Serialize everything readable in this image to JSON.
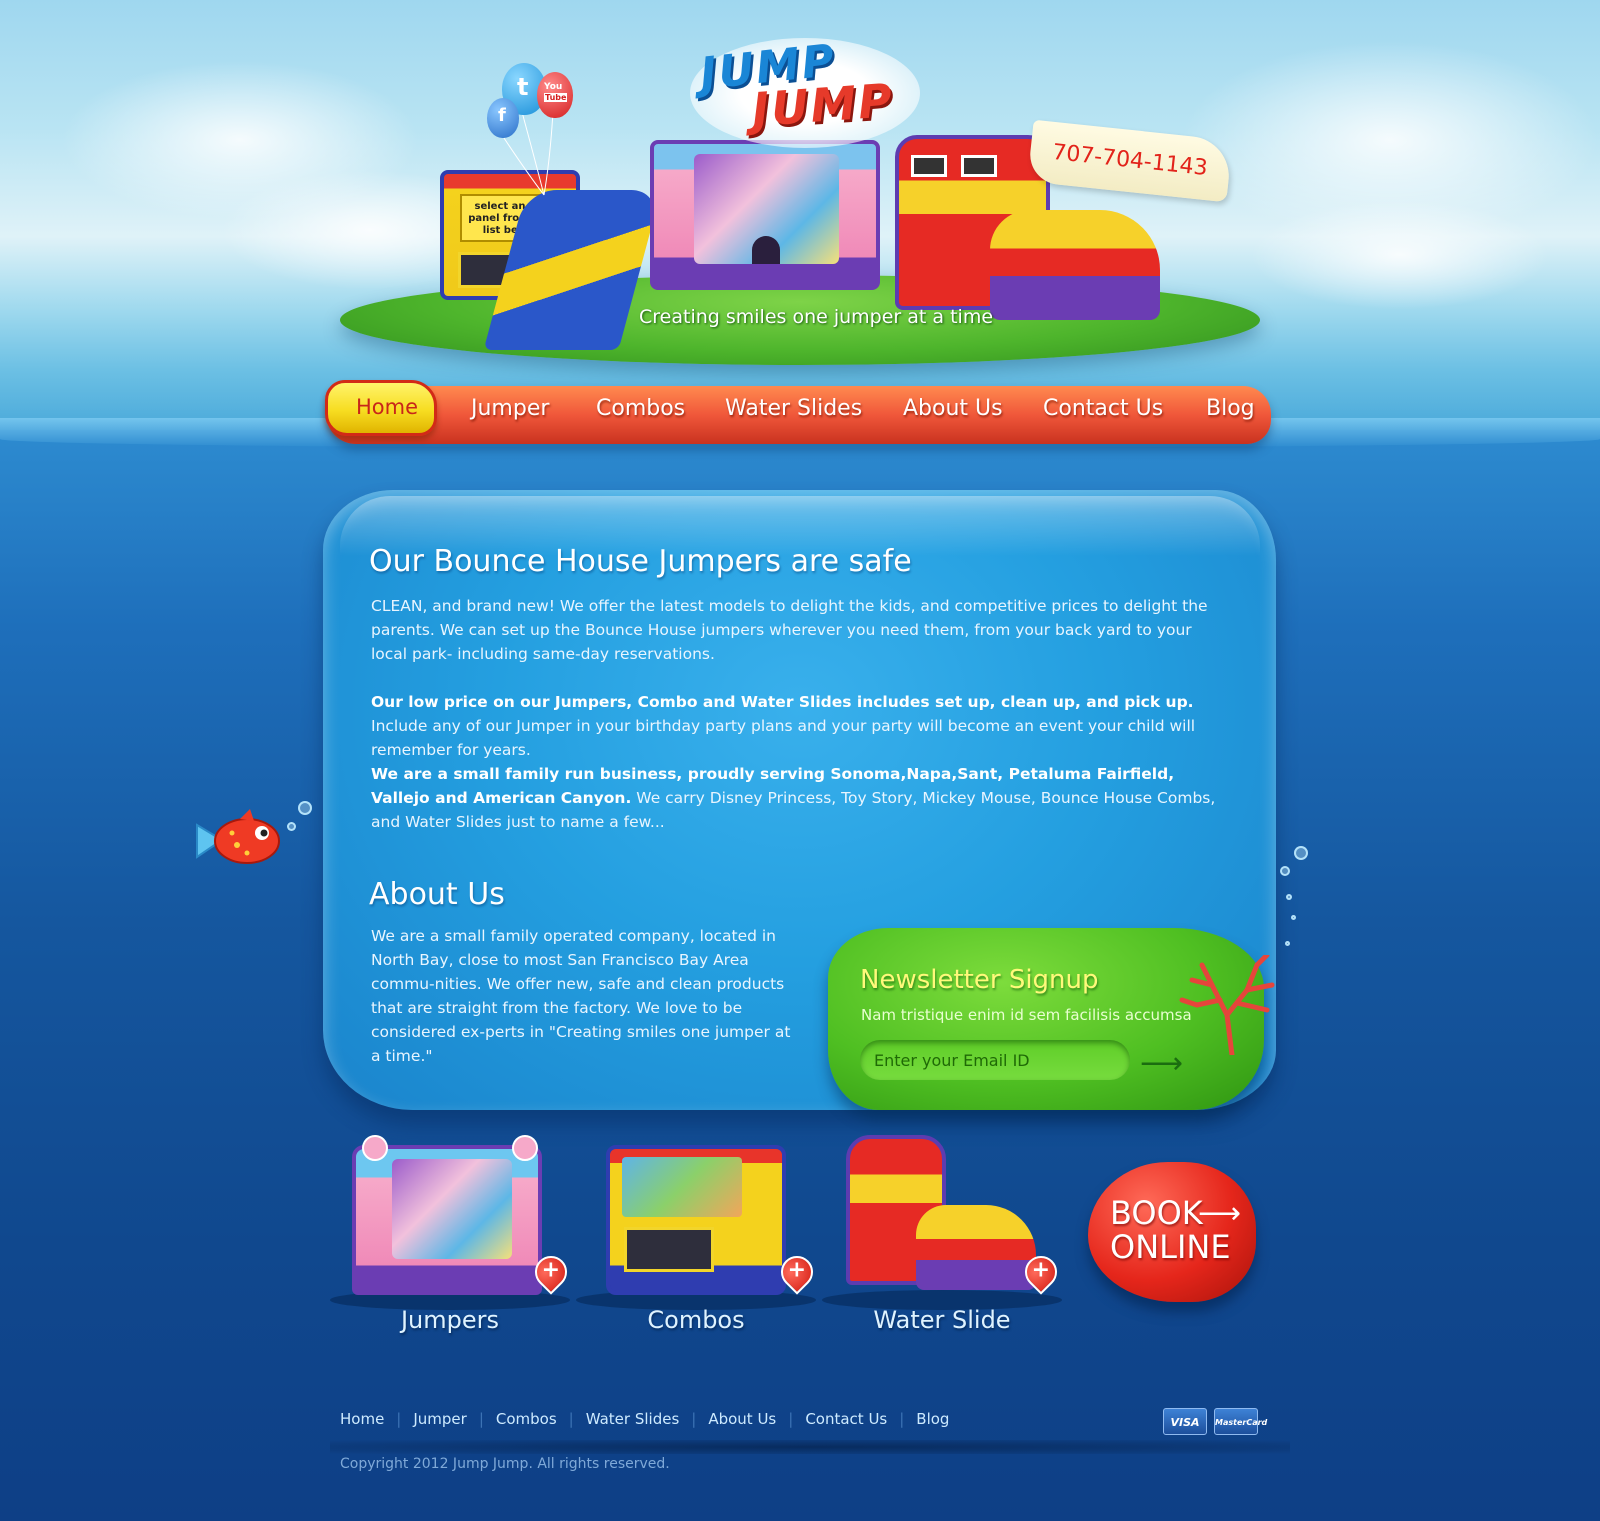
{
  "header": {
    "logo_line1": "JUMP",
    "logo_line2": "JUMP",
    "tagline": "Creating smiles one jumper at a time",
    "phone": "707-704-1143",
    "art_panel": "select an art panel from the list below",
    "social": [
      {
        "name": "twitter-icon",
        "glyph": "t"
      },
      {
        "name": "youtube-icon",
        "line1": "You",
        "line2": "Tube"
      },
      {
        "name": "facebook-icon",
        "glyph": "f"
      }
    ]
  },
  "nav": {
    "items": [
      "Home",
      "Jumper",
      "Combos",
      "Water Slides",
      "About Us",
      "Contact Us",
      "Blog"
    ],
    "active": "Home"
  },
  "main": {
    "safe_title": "Our Bounce House Jumpers are safe",
    "safe_p1": "CLEAN, and brand new! We offer the latest models to delight the kids, and competitive prices to delight the parents. We can set up the Bounce House jumpers wherever you need them, from your back yard to your local park- including same-day reservations.",
    "safe_p2_bold": "Our low price on our Jumpers, Combo and Water Slides includes set up, clean up, and pick up.",
    "safe_p2_rest": " Include any of our Jumper in your birthday party plans and your party will become an event your child will remember for years.",
    "safe_p3_bold": "We are a small family run business, proudly serving Sonoma,Napa,Sant, Petaluma Fairfield, Vallejo and American Canyon.",
    "safe_p3_rest": " We carry Disney Princess, Toy Story, Mickey Mouse, Bounce House Combs, and Water Slides just to name a few...",
    "about_title": "About Us",
    "about_text": "We are a small family operated company, located in North Bay, close to most San Francisco Bay Area commu-nities. We offer new, safe and clean products that are straight from the factory. We love to be considered ex-perts in \"Creating smiles one jumper at a time.\""
  },
  "newsletter": {
    "title": "Newsletter Signup",
    "subtitle": "Nam tristique enim id sem facilisis accumsa",
    "placeholder": "Enter your Email ID",
    "value": ""
  },
  "products": [
    {
      "label": "Jumpers"
    },
    {
      "label": "Combos"
    },
    {
      "label": "Water Slide"
    }
  ],
  "book": {
    "line1": "BOOK",
    "line2": "ONLINE"
  },
  "footer": {
    "links": [
      "Home",
      "Jumper",
      "Combos",
      "Water Slides",
      "About Us",
      "Contact Us",
      "Blog"
    ],
    "copyright": "Copyright 2012 Jump Jump. All rights reserved.",
    "cards": [
      "VISA",
      "MasterCard"
    ]
  },
  "colors": {
    "sea": "#0e4a94",
    "nav_orange": "#f0573a",
    "nav_active": "#f7dd21",
    "bubble": "#249fe0",
    "newsletter_green": "#4fbf22",
    "book_red": "#e5261b"
  }
}
